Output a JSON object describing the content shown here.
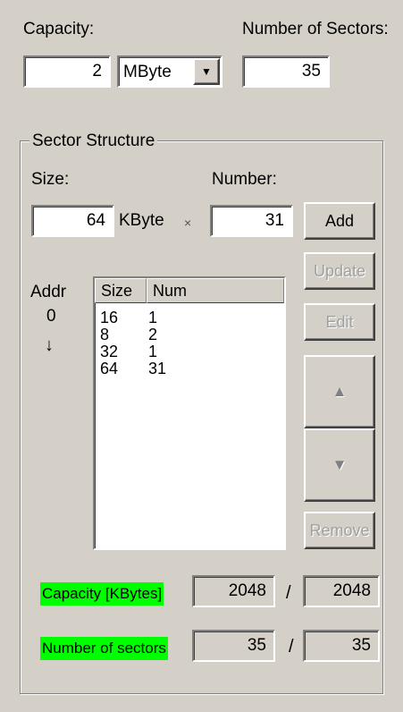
{
  "capacity": {
    "label": "Capacity:",
    "value": "2",
    "unit": "MByte"
  },
  "num_sectors": {
    "label": "Number of Sectors:",
    "value": "35"
  },
  "sector_structure": {
    "title": "Sector Structure",
    "size_label": "Size:",
    "size_value": "64",
    "size_unit": "KByte",
    "times": "×",
    "number_label": "Number:",
    "number_value": "31",
    "add_label": "Add",
    "update_label": "Update",
    "edit_label": "Edit",
    "remove_label": "Remove",
    "addr_label": "Addr",
    "addr_value": "0",
    "addr_arrow": "↓",
    "up_glyph": "▲",
    "down_glyph": "▼",
    "list": {
      "headers": [
        "Size",
        "Num"
      ],
      "rows": [
        {
          "size": "16",
          "num": "1"
        },
        {
          "size": "8",
          "num": "2"
        },
        {
          "size": "32",
          "num": "1"
        },
        {
          "size": "64",
          "num": "31"
        }
      ]
    }
  },
  "summary": {
    "capacity_label": "Capacity [KBytes]",
    "capacity_value": "2048",
    "capacity_total": "2048",
    "sectors_label": "Number of sectors",
    "sectors_value": "35",
    "sectors_total": "35",
    "separator": "/"
  },
  "colors": {
    "highlight": "#00ff00",
    "window_bg": "#d4d0c8"
  }
}
